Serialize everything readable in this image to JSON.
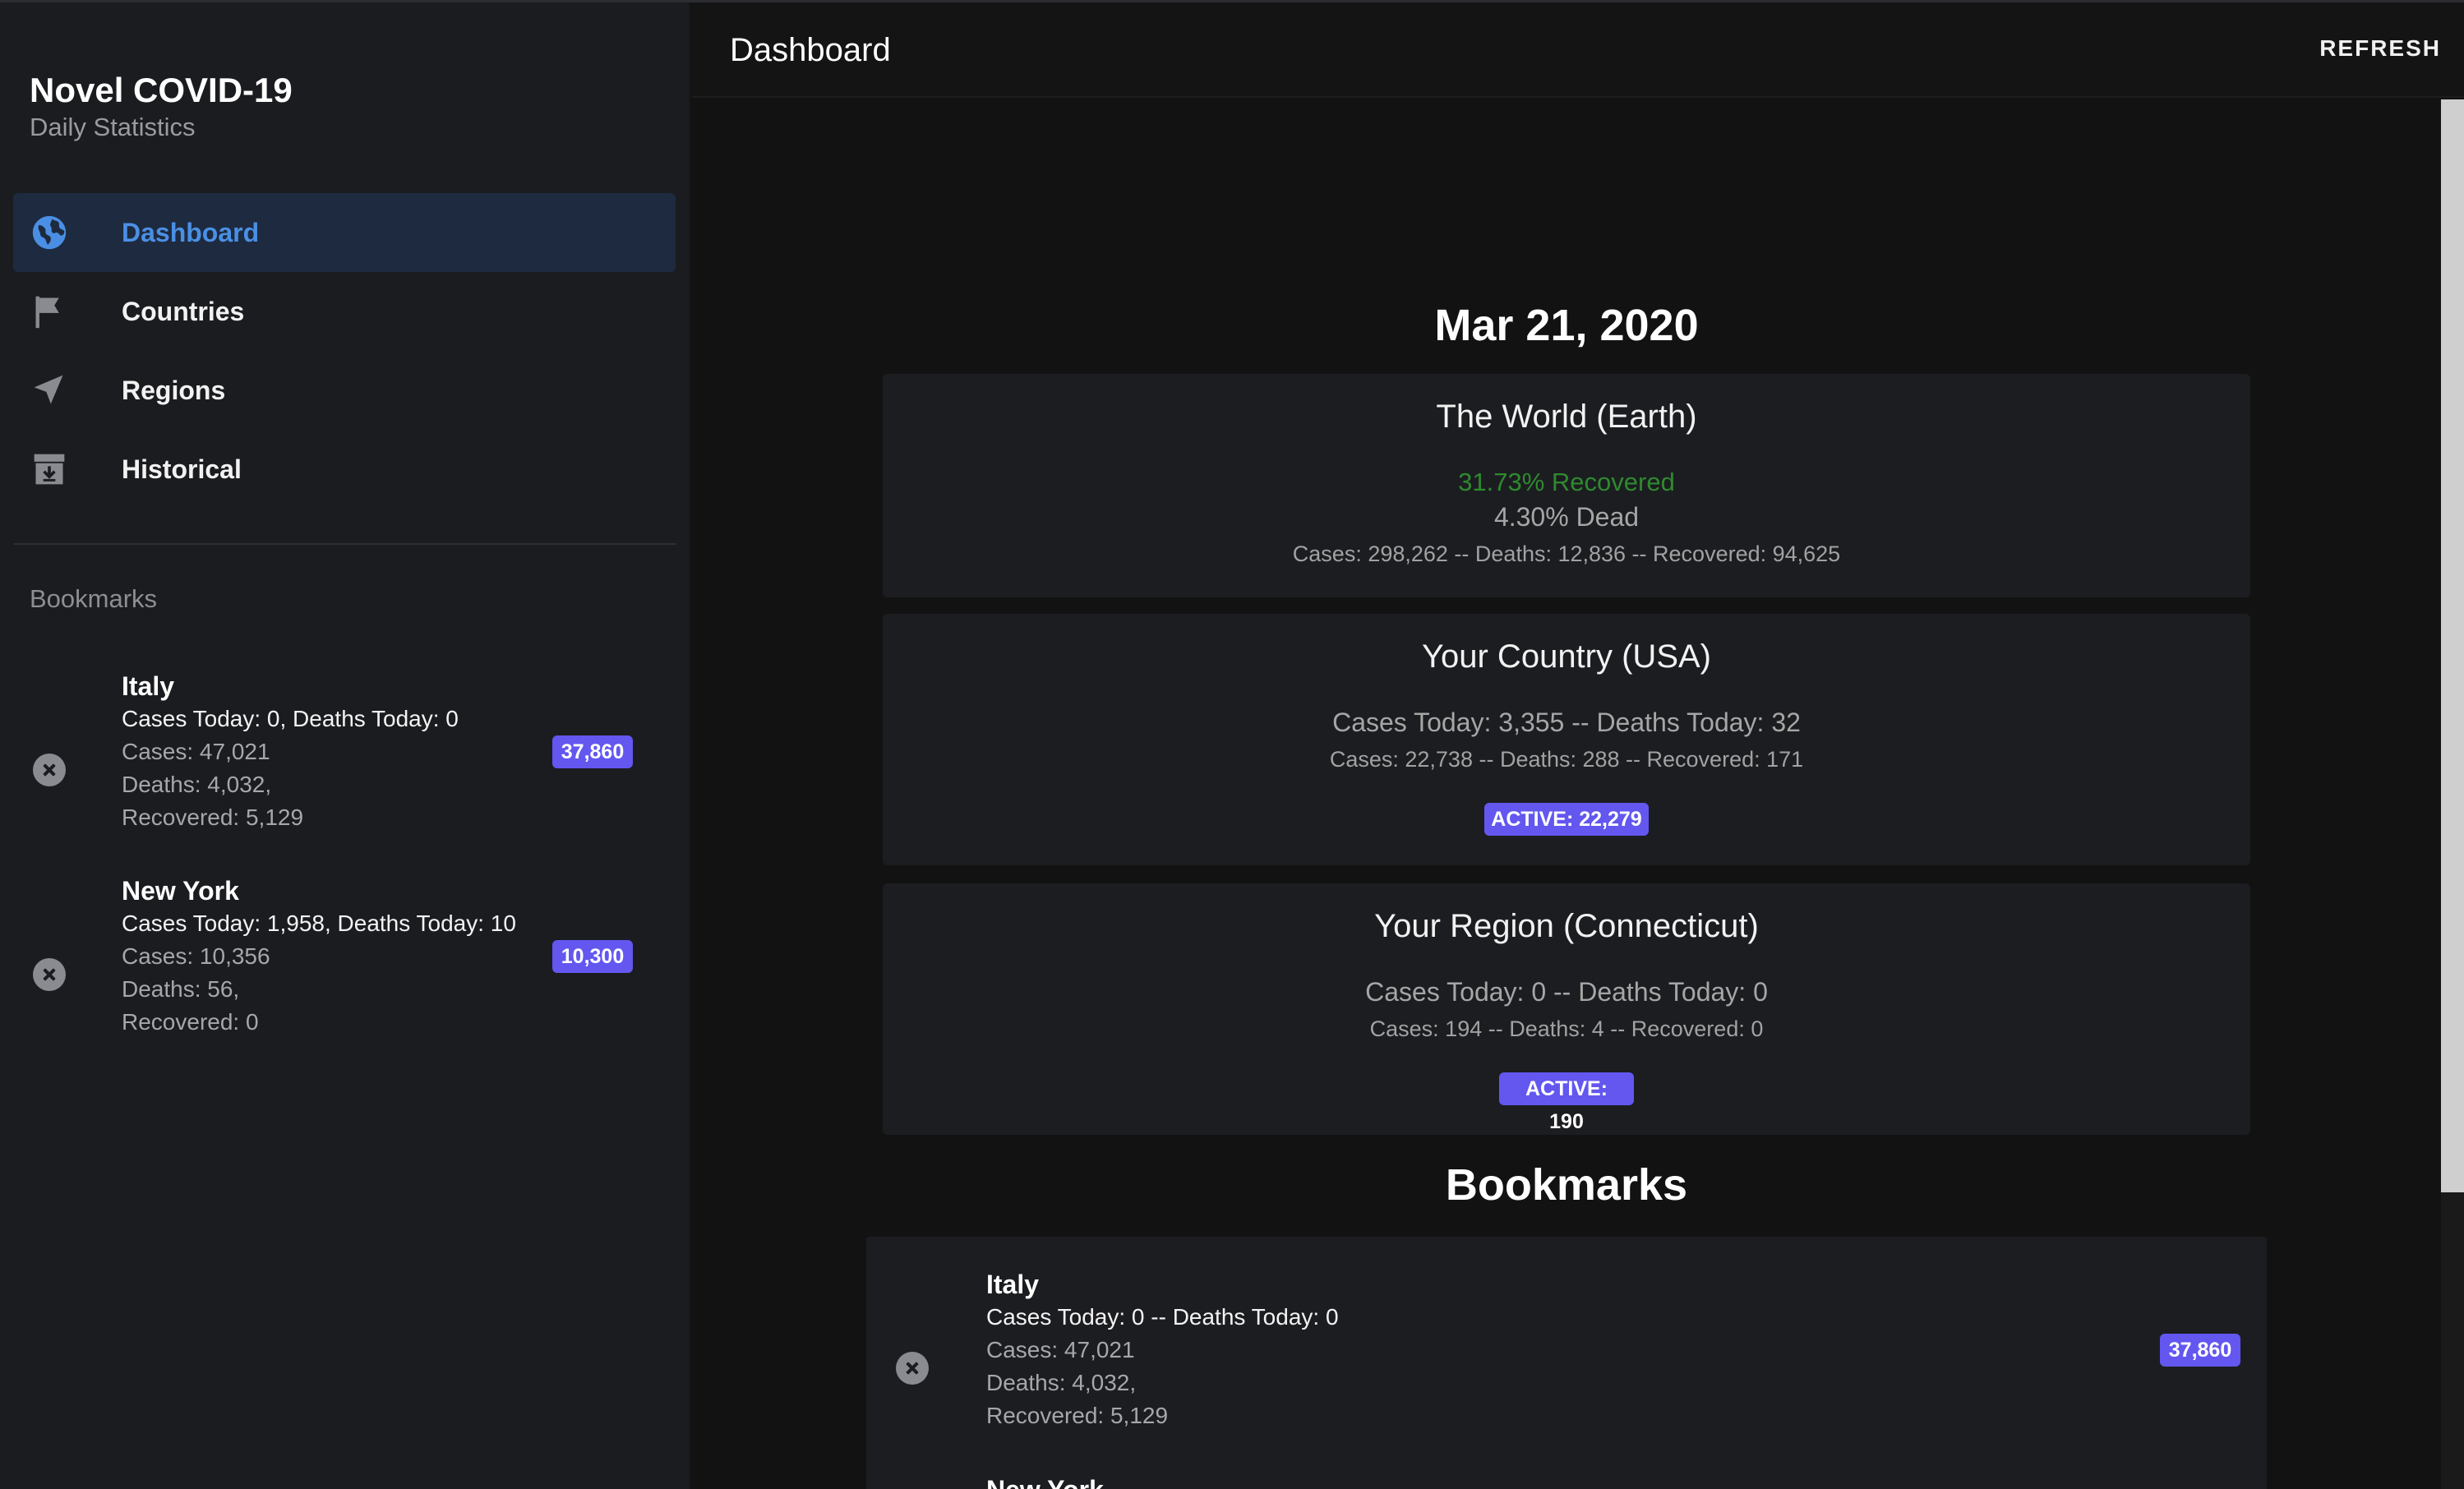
{
  "app": {
    "title": "Novel COVID-19",
    "subtitle": "Daily Statistics"
  },
  "nav": {
    "items": [
      {
        "label": "Dashboard",
        "icon": "globe-icon",
        "active": true
      },
      {
        "label": "Countries",
        "icon": "flag-icon",
        "active": false
      },
      {
        "label": "Regions",
        "icon": "navigation-arrow-icon",
        "active": false
      },
      {
        "label": "Historical",
        "icon": "archive-icon",
        "active": false
      }
    ]
  },
  "sidebar_bookmarks": {
    "title": "Bookmarks",
    "items": [
      {
        "name": "Italy",
        "today": "Cases Today: 0, Deaths Today: 0",
        "cases": "Cases: 47,021",
        "deaths": "Deaths: 4,032,",
        "recovered": "Recovered: 5,129",
        "badge": "37,860"
      },
      {
        "name": "New York",
        "today": "Cases Today: 1,958, Deaths Today: 10",
        "cases": "Cases: 10,356",
        "deaths": "Deaths: 56,",
        "recovered": "Recovered: 0",
        "badge": "10,300"
      }
    ]
  },
  "header": {
    "title": "Dashboard",
    "refresh_label": "REFRESH"
  },
  "dashboard": {
    "date": "Mar 21, 2020",
    "world": {
      "title": "The World (Earth)",
      "recovered_pct": "31.73% Recovered",
      "dead_pct": "4.30% Dead",
      "totals": "Cases: 298,262 -- Deaths: 12,836 -- Recovered: 94,625"
    },
    "country": {
      "title": "Your Country (USA)",
      "today": "Cases Today: 3,355 -- Deaths Today: 32",
      "totals": "Cases: 22,738 -- Deaths: 288 -- Recovered: 171",
      "active": "ACTIVE: 22,279"
    },
    "region": {
      "title": "Your Region (Connecticut)",
      "today": "Cases Today: 0 -- Deaths Today: 0",
      "totals": "Cases: 194 -- Deaths: 4 -- Recovered: 0",
      "active": "ACTIVE: 190"
    },
    "bookmarks_title": "Bookmarks",
    "bookmarks": [
      {
        "name": "Italy",
        "today": "Cases Today: 0 -- Deaths Today: 0",
        "cases": "Cases: 47,021",
        "deaths": "Deaths: 4,032,",
        "recovered": "Recovered: 5,129",
        "badge": "37,860"
      },
      {
        "name": "New York"
      }
    ]
  },
  "colors": {
    "accent": "#4a8fe4",
    "badge": "#6357f0",
    "recovered": "#2e8a2e"
  }
}
